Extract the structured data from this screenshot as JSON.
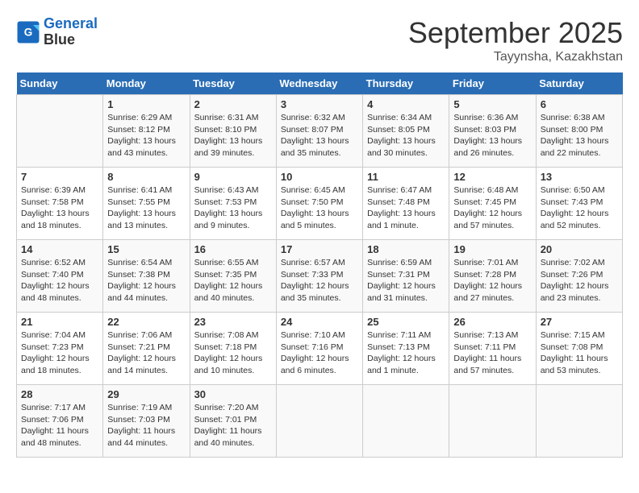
{
  "header": {
    "logo_line1": "General",
    "logo_line2": "Blue",
    "month_title": "September 2025",
    "location": "Tayynsha, Kazakhstan"
  },
  "weekdays": [
    "Sunday",
    "Monday",
    "Tuesday",
    "Wednesday",
    "Thursday",
    "Friday",
    "Saturday"
  ],
  "weeks": [
    [
      {
        "day": "",
        "info": ""
      },
      {
        "day": "1",
        "info": "Sunrise: 6:29 AM\nSunset: 8:12 PM\nDaylight: 13 hours\nand 43 minutes."
      },
      {
        "day": "2",
        "info": "Sunrise: 6:31 AM\nSunset: 8:10 PM\nDaylight: 13 hours\nand 39 minutes."
      },
      {
        "day": "3",
        "info": "Sunrise: 6:32 AM\nSunset: 8:07 PM\nDaylight: 13 hours\nand 35 minutes."
      },
      {
        "day": "4",
        "info": "Sunrise: 6:34 AM\nSunset: 8:05 PM\nDaylight: 13 hours\nand 30 minutes."
      },
      {
        "day": "5",
        "info": "Sunrise: 6:36 AM\nSunset: 8:03 PM\nDaylight: 13 hours\nand 26 minutes."
      },
      {
        "day": "6",
        "info": "Sunrise: 6:38 AM\nSunset: 8:00 PM\nDaylight: 13 hours\nand 22 minutes."
      }
    ],
    [
      {
        "day": "7",
        "info": "Sunrise: 6:39 AM\nSunset: 7:58 PM\nDaylight: 13 hours\nand 18 minutes."
      },
      {
        "day": "8",
        "info": "Sunrise: 6:41 AM\nSunset: 7:55 PM\nDaylight: 13 hours\nand 13 minutes."
      },
      {
        "day": "9",
        "info": "Sunrise: 6:43 AM\nSunset: 7:53 PM\nDaylight: 13 hours\nand 9 minutes."
      },
      {
        "day": "10",
        "info": "Sunrise: 6:45 AM\nSunset: 7:50 PM\nDaylight: 13 hours\nand 5 minutes."
      },
      {
        "day": "11",
        "info": "Sunrise: 6:47 AM\nSunset: 7:48 PM\nDaylight: 13 hours\nand 1 minute."
      },
      {
        "day": "12",
        "info": "Sunrise: 6:48 AM\nSunset: 7:45 PM\nDaylight: 12 hours\nand 57 minutes."
      },
      {
        "day": "13",
        "info": "Sunrise: 6:50 AM\nSunset: 7:43 PM\nDaylight: 12 hours\nand 52 minutes."
      }
    ],
    [
      {
        "day": "14",
        "info": "Sunrise: 6:52 AM\nSunset: 7:40 PM\nDaylight: 12 hours\nand 48 minutes."
      },
      {
        "day": "15",
        "info": "Sunrise: 6:54 AM\nSunset: 7:38 PM\nDaylight: 12 hours\nand 44 minutes."
      },
      {
        "day": "16",
        "info": "Sunrise: 6:55 AM\nSunset: 7:35 PM\nDaylight: 12 hours\nand 40 minutes."
      },
      {
        "day": "17",
        "info": "Sunrise: 6:57 AM\nSunset: 7:33 PM\nDaylight: 12 hours\nand 35 minutes."
      },
      {
        "day": "18",
        "info": "Sunrise: 6:59 AM\nSunset: 7:31 PM\nDaylight: 12 hours\nand 31 minutes."
      },
      {
        "day": "19",
        "info": "Sunrise: 7:01 AM\nSunset: 7:28 PM\nDaylight: 12 hours\nand 27 minutes."
      },
      {
        "day": "20",
        "info": "Sunrise: 7:02 AM\nSunset: 7:26 PM\nDaylight: 12 hours\nand 23 minutes."
      }
    ],
    [
      {
        "day": "21",
        "info": "Sunrise: 7:04 AM\nSunset: 7:23 PM\nDaylight: 12 hours\nand 18 minutes."
      },
      {
        "day": "22",
        "info": "Sunrise: 7:06 AM\nSunset: 7:21 PM\nDaylight: 12 hours\nand 14 minutes."
      },
      {
        "day": "23",
        "info": "Sunrise: 7:08 AM\nSunset: 7:18 PM\nDaylight: 12 hours\nand 10 minutes."
      },
      {
        "day": "24",
        "info": "Sunrise: 7:10 AM\nSunset: 7:16 PM\nDaylight: 12 hours\nand 6 minutes."
      },
      {
        "day": "25",
        "info": "Sunrise: 7:11 AM\nSunset: 7:13 PM\nDaylight: 12 hours\nand 1 minute."
      },
      {
        "day": "26",
        "info": "Sunrise: 7:13 AM\nSunset: 7:11 PM\nDaylight: 11 hours\nand 57 minutes."
      },
      {
        "day": "27",
        "info": "Sunrise: 7:15 AM\nSunset: 7:08 PM\nDaylight: 11 hours\nand 53 minutes."
      }
    ],
    [
      {
        "day": "28",
        "info": "Sunrise: 7:17 AM\nSunset: 7:06 PM\nDaylight: 11 hours\nand 48 minutes."
      },
      {
        "day": "29",
        "info": "Sunrise: 7:19 AM\nSunset: 7:03 PM\nDaylight: 11 hours\nand 44 minutes."
      },
      {
        "day": "30",
        "info": "Sunrise: 7:20 AM\nSunset: 7:01 PM\nDaylight: 11 hours\nand 40 minutes."
      },
      {
        "day": "",
        "info": ""
      },
      {
        "day": "",
        "info": ""
      },
      {
        "day": "",
        "info": ""
      },
      {
        "day": "",
        "info": ""
      }
    ]
  ]
}
